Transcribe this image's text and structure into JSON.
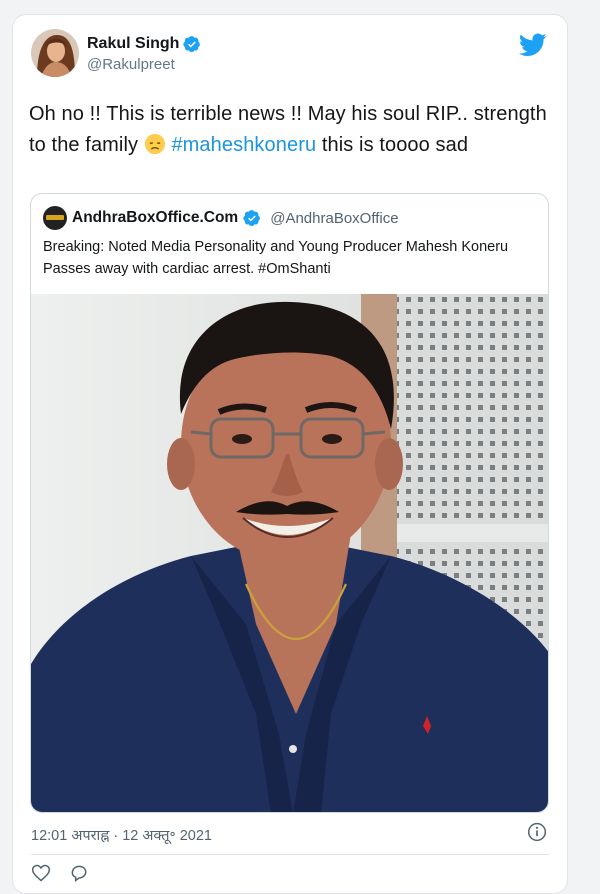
{
  "tweet": {
    "author": {
      "display_name": "Rakul Singh",
      "handle": "@Rakulpreet"
    },
    "text_before": "Oh no !! This is terrible news !! May his soul RIP.. strength to the family ",
    "emoji": "disappointed-face",
    "hashtag": "#maheshkoneru",
    "text_after": " this is toooo sad",
    "timestamp": "12:01 अपराह्न · 12 अक्तू॰ 2021"
  },
  "quoted_tweet": {
    "display_name": "AndhraBoxOffice.Com",
    "handle": "@AndhraBoxOffice",
    "text": "Breaking: Noted Media Personality and Young Producer Mahesh Koneru Passes away with cardiac arrest. #OmShanti"
  },
  "icons": {
    "brand": "twitter-bird-icon",
    "verified": "verified-badge-icon",
    "info": "info-icon"
  },
  "colors": {
    "twitter_blue": "#1da1f2",
    "hashtag": "#1b95e0",
    "secondary_text": "#657786"
  }
}
